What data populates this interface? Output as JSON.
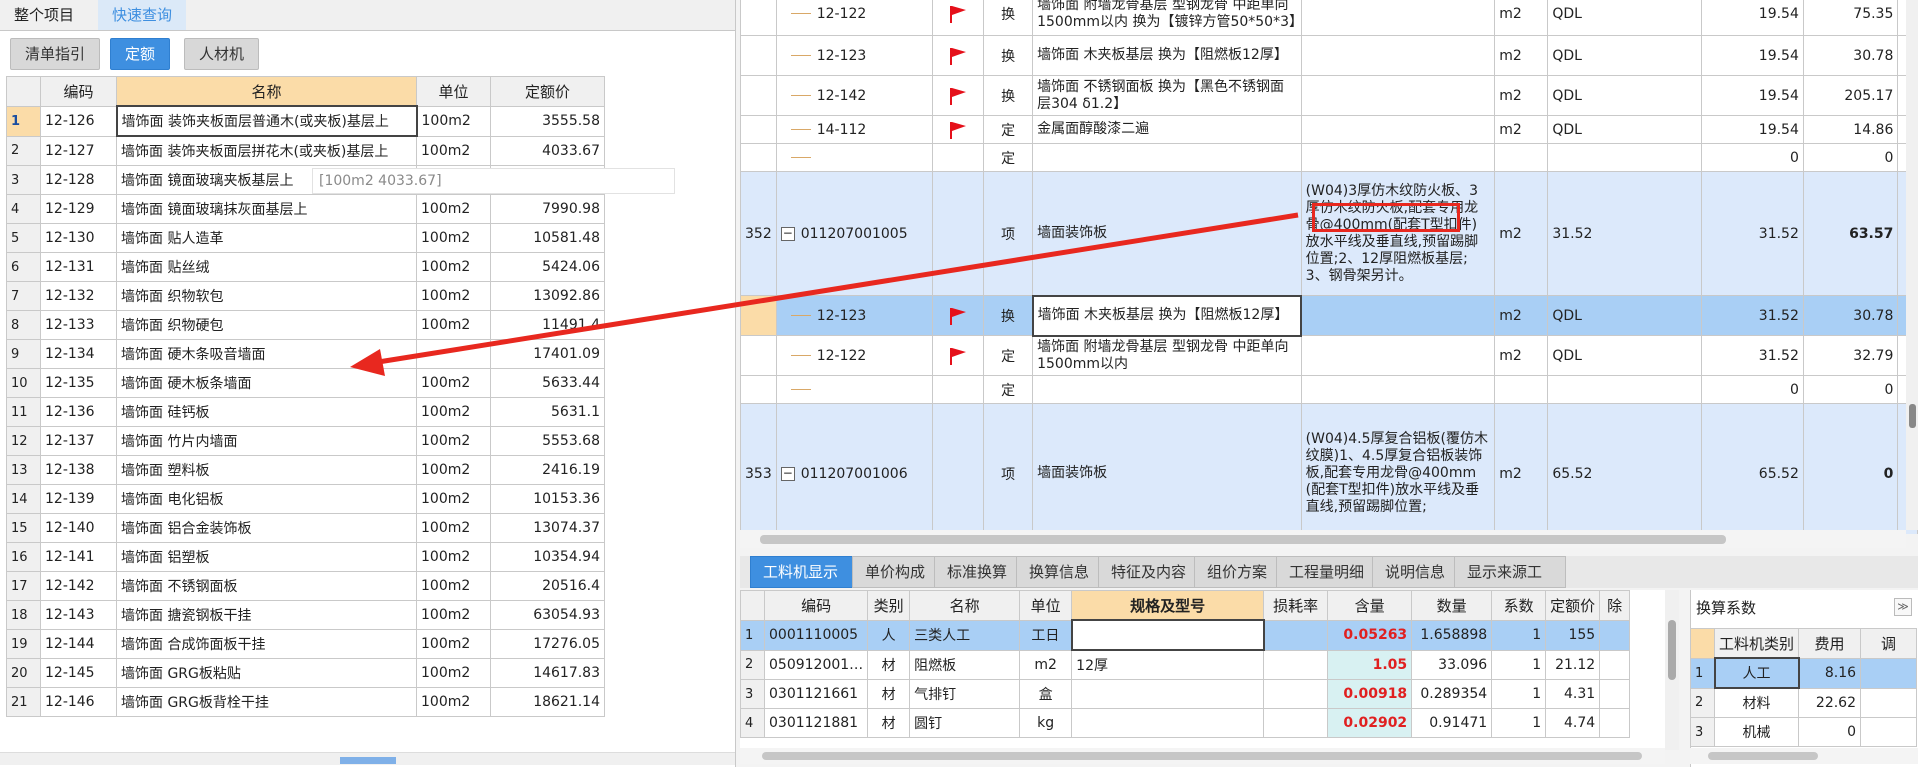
{
  "left_panel": {
    "top_tabs": [
      "整个项目",
      "快速查询"
    ],
    "sub_tabs": [
      "清单指引",
      "定额",
      "人材机"
    ],
    "columns": [
      "编码",
      "名称",
      "单位",
      "定额价"
    ],
    "rows": [
      {
        "n": "1",
        "code": "12-126",
        "name": "墙饰面 装饰夹板面层普通木(或夹板)基层上",
        "unit": "100m2",
        "price": "3555.58"
      },
      {
        "n": "2",
        "code": "12-127",
        "name": "墙饰面 装饰夹板面层拼花木(或夹板)基层上",
        "unit": "100m2",
        "price": "4033.67"
      },
      {
        "n": "3",
        "code": "12-128",
        "name": "墙饰面 镜面玻璃夹板基层上",
        "unit": "",
        "price": ""
      },
      {
        "n": "4",
        "code": "12-129",
        "name": "墙饰面 镜面玻璃抹灰面基层上",
        "unit": "100m2",
        "price": "7990.98"
      },
      {
        "n": "5",
        "code": "12-130",
        "name": "墙饰面 贴人造革",
        "unit": "100m2",
        "price": "10581.48"
      },
      {
        "n": "6",
        "code": "12-131",
        "name": "墙饰面 贴丝绒",
        "unit": "100m2",
        "price": "5424.06"
      },
      {
        "n": "7",
        "code": "12-132",
        "name": "墙饰面 织物软包",
        "unit": "100m2",
        "price": "13092.86"
      },
      {
        "n": "8",
        "code": "12-133",
        "name": "墙饰面 织物硬包",
        "unit": "100m2",
        "price": "11491.4"
      },
      {
        "n": "9",
        "code": "12-134",
        "name": "墙饰面 硬木条吸音墙面",
        "unit": "",
        "price": "17401.09"
      },
      {
        "n": "10",
        "code": "12-135",
        "name": "墙饰面 硬木板条墙面",
        "unit": "100m2",
        "price": "5633.44"
      },
      {
        "n": "11",
        "code": "12-136",
        "name": "墙饰面 硅钙板",
        "unit": "100m2",
        "price": "5631.1"
      },
      {
        "n": "12",
        "code": "12-137",
        "name": "墙饰面 竹片内墙面",
        "unit": "100m2",
        "price": "5553.68"
      },
      {
        "n": "13",
        "code": "12-138",
        "name": "墙饰面 塑料板",
        "unit": "100m2",
        "price": "2416.19"
      },
      {
        "n": "14",
        "code": "12-139",
        "name": "墙饰面 电化铝板",
        "unit": "100m2",
        "price": "10153.36"
      },
      {
        "n": "15",
        "code": "12-140",
        "name": "墙饰面 铝合金装饰板",
        "unit": "100m2",
        "price": "13074.37"
      },
      {
        "n": "16",
        "code": "12-141",
        "name": "墙饰面 铝塑板",
        "unit": "100m2",
        "price": "10354.94"
      },
      {
        "n": "17",
        "code": "12-142",
        "name": "墙饰面 不锈钢面板",
        "unit": "100m2",
        "price": "20516.4"
      },
      {
        "n": "18",
        "code": "12-143",
        "name": "墙饰面 搪瓷钢板干挂",
        "unit": "100m2",
        "price": "63054.93"
      },
      {
        "n": "19",
        "code": "12-144",
        "name": "墙饰面 合成饰面板干挂",
        "unit": "100m2",
        "price": "17276.05"
      },
      {
        "n": "20",
        "code": "12-145",
        "name": "墙饰面 GRG板粘贴",
        "unit": "100m2",
        "price": "14617.83"
      },
      {
        "n": "21",
        "code": "12-146",
        "name": "墙饰面 GRG板背栓干挂",
        "unit": "100m2",
        "price": "18621.14"
      }
    ],
    "tooltip": "[100m2 4033.67]"
  },
  "right_grid": {
    "rows": [
      {
        "type": "sub",
        "code": "12-122",
        "flag": true,
        "kind": "换",
        "name": "墙饰面 附墙龙骨基层 型钢龙骨 中距单向1500mm以内  换为【镀锌方管50*50*3】",
        "spec": "",
        "unit": "m2",
        "expr": "QDL",
        "qty": "19.54",
        "price": "75.35",
        "h": 44
      },
      {
        "type": "sub",
        "code": "12-123",
        "flag": true,
        "kind": "换",
        "name": "墙饰面 木夹板基层  换为【阻燃板12厚】",
        "spec": "",
        "unit": "m2",
        "expr": "QDL",
        "qty": "19.54",
        "price": "30.78",
        "h": 40
      },
      {
        "type": "sub",
        "code": "12-142",
        "flag": true,
        "kind": "换",
        "name": "墙饰面 不锈钢面板  换为【黑色不锈钢面层304 δ1.2】",
        "spec": "",
        "unit": "m2",
        "expr": "QDL",
        "qty": "19.54",
        "price": "205.17",
        "h": 40
      },
      {
        "type": "sub",
        "code": "14-112",
        "flag": true,
        "kind": "定",
        "name": "金属面醇酸漆二遍",
        "spec": "",
        "unit": "m2",
        "expr": "QDL",
        "qty": "19.54",
        "price": "14.86",
        "h": 28
      },
      {
        "type": "sub",
        "code": "",
        "flag": false,
        "kind": "定",
        "name": "",
        "spec": "",
        "unit": "",
        "expr": "",
        "qty": "0",
        "price": "0",
        "h": 28
      },
      {
        "type": "main",
        "num": "352",
        "code": "011207001005",
        "kind": "项",
        "name": "墙面装饰板",
        "spec": "(W04)3厚仿木纹防火板、3厚仿木纹防火板,配套专用龙骨@400mm(配套T型扣件)放水平线及垂直线,预留踢脚位置;2、12厚阻燃板基层;3、钢骨架另计。",
        "unit": "m2",
        "expr": "31.52",
        "qty": "31.52",
        "price": "63.57",
        "h": 124
      },
      {
        "type": "sel",
        "code": "12-123",
        "flag": true,
        "kind": "换",
        "name": "墙饰面 木夹板基层  换为【阻燃板12厚】",
        "spec": "",
        "unit": "m2",
        "expr": "QDL",
        "qty": "31.52",
        "price": "30.78",
        "h": 40
      },
      {
        "type": "sub",
        "code": "12-122",
        "flag": true,
        "kind": "定",
        "name": "墙饰面 附墙龙骨基层 型钢龙骨 中距单向1500mm以内",
        "spec": "",
        "unit": "m2",
        "expr": "QDL",
        "qty": "31.52",
        "price": "32.79",
        "h": 40
      },
      {
        "type": "sub",
        "code": "",
        "flag": false,
        "kind": "定",
        "name": "",
        "spec": "",
        "unit": "",
        "expr": "",
        "qty": "0",
        "price": "0",
        "h": 28
      },
      {
        "type": "main",
        "num": "353",
        "code": "011207001006",
        "kind": "项",
        "name": "墙面装饰板",
        "spec": "(W04)4.5厚复合铝板(覆仿木纹膜)1、4.5厚复合铝板装饰板,配套专用龙骨@400mm(配套T型扣件)放水平线及垂直线,预留踢脚位置;",
        "unit": "m2",
        "expr": "65.52",
        "qty": "65.52",
        "price": "0",
        "h": 140
      }
    ]
  },
  "bottom_tabs": [
    "工料机显示",
    "单价构成",
    "标准换算",
    "换算信息",
    "特征及内容",
    "组价方案",
    "工程量明细",
    "说明信息",
    "显示来源工程"
  ],
  "bottom_grid": {
    "columns": [
      "编码",
      "类别",
      "名称",
      "单位",
      "规格及型号",
      "损耗率",
      "含量",
      "数量",
      "系数",
      "定额价",
      "除"
    ],
    "rows": [
      {
        "n": "1",
        "code": "0001110005",
        "cat": "人",
        "name": "三类人工",
        "unit": "工日",
        "spec": "",
        "content": "0.05263",
        "qty": "1.658898",
        "coef": "1",
        "price": "155"
      },
      {
        "n": "2",
        "code": "050912001…",
        "cat": "材",
        "name": "阻燃板",
        "unit": "m2",
        "spec": "12厚",
        "content": "1.05",
        "qty": "33.096",
        "coef": "1",
        "price": "21.12"
      },
      {
        "n": "3",
        "code": "0301121661",
        "cat": "材",
        "name": "气排钉",
        "unit": "盒",
        "spec": "",
        "content": "0.00918",
        "qty": "0.289354",
        "coef": "1",
        "price": "4.31"
      },
      {
        "n": "4",
        "code": "0301121881",
        "cat": "材",
        "name": "圆钉",
        "unit": "kg",
        "spec": "",
        "content": "0.02902",
        "qty": "0.91471",
        "coef": "1",
        "price": "4.74"
      }
    ]
  },
  "coef_panel": {
    "title": "换算系数",
    "columns": [
      "工料机类别",
      "费用",
      "调"
    ],
    "rows": [
      {
        "n": "1",
        "cat": "人工",
        "fee": "8.16"
      },
      {
        "n": "2",
        "cat": "材料",
        "fee": "22.62"
      },
      {
        "n": "3",
        "cat": "机械",
        "fee": "0"
      }
    ]
  },
  "colors": {
    "accent": "#3e8fe0",
    "header_highlight": "#fbdca8",
    "selected_row": "#a9cff5",
    "main_row": "#dce9fb",
    "annotation": "#e8281f",
    "flag": "#e5101a"
  }
}
